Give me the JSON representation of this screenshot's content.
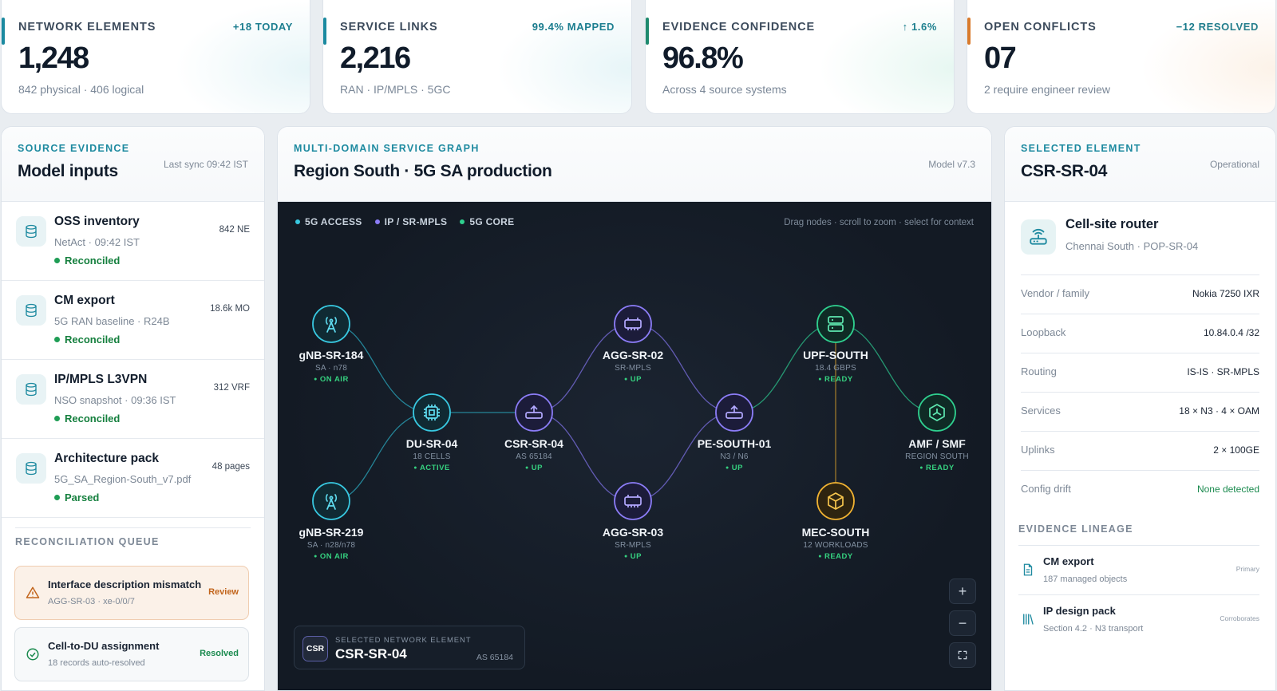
{
  "kpis": [
    {
      "label": "NETWORK ELEMENTS",
      "badge": "+18 TODAY",
      "value": "1,248",
      "sub": "842 physical · 406 logical"
    },
    {
      "label": "SERVICE LINKS",
      "badge": "99.4% MAPPED",
      "value": "2,216",
      "sub": "RAN · IP/MPLS · 5GC"
    },
    {
      "label": "EVIDENCE CONFIDENCE",
      "badge": "↑ 1.6%",
      "value": "96.8%",
      "sub": "Across 4 source systems"
    },
    {
      "label": "OPEN CONFLICTS",
      "badge": "−12 RESOLVED",
      "value": "07",
      "sub": "2 require engineer review"
    }
  ],
  "kpi_accents": [
    "#1b8aa0",
    "#1b8aa0",
    "#1f8a6e",
    "#d97a2b"
  ],
  "left": {
    "eyebrow": "SOURCE EVIDENCE",
    "title": "Model inputs",
    "meta": "Last sync 09:42 IST",
    "sources": [
      {
        "title": "OSS inventory",
        "sub": "NetAct · 09:42 IST",
        "status": "Reconciled",
        "count": "842 NE",
        "icon": "database-icon"
      },
      {
        "title": "CM export",
        "sub": "5G RAN baseline · R24B",
        "status": "Reconciled",
        "count": "18.6k MO",
        "icon": "database-icon"
      },
      {
        "title": "IP/MPLS L3VPN",
        "sub": "NSO snapshot · 09:36 IST",
        "status": "Reconciled",
        "count": "312 VRF",
        "icon": "database-icon"
      },
      {
        "title": "Architecture pack",
        "sub": "5G_SA_Region-South_v7.pdf",
        "status": "Parsed",
        "count": "48 pages",
        "icon": "database-icon"
      }
    ],
    "queue_label": "RECONCILIATION QUEUE",
    "queue": [
      {
        "title": "Interface description mismatch",
        "sub": "AGG-SR-03 · xe-0/0/7",
        "action": "Review",
        "icon": "warning-icon"
      },
      {
        "title": "Cell-to-DU assignment",
        "sub": "18 records auto-resolved",
        "action": "Resolved",
        "icon": "check-circle-icon"
      }
    ]
  },
  "center": {
    "eyebrow": "MULTI-DOMAIN SERVICE GRAPH",
    "title": "Region South · 5G SA production",
    "meta": "Model v7.3",
    "legend": [
      {
        "label": "5G ACCESS",
        "color": "#38c8e0"
      },
      {
        "label": "IP / SR-MPLS",
        "color": "#8b7cf6"
      },
      {
        "label": "5G CORE",
        "color": "#2fd08f"
      }
    ],
    "hint": "Drag nodes · scroll to zoom · select for context",
    "nodes": [
      {
        "id": "gnb184",
        "name": "gNB-SR-184",
        "sub": "SA · n78",
        "status": "ON AIR",
        "domain": "access",
        "icon": "antenna-icon"
      },
      {
        "id": "gnb219",
        "name": "gNB-SR-219",
        "sub": "SA · n28/n78",
        "status": "ON AIR",
        "domain": "access",
        "icon": "antenna-icon"
      },
      {
        "id": "du04",
        "name": "DU-SR-04",
        "sub": "18 CELLS",
        "status": "ACTIVE",
        "domain": "access",
        "icon": "chip-icon"
      },
      {
        "id": "csr04",
        "name": "CSR-SR-04",
        "sub": "AS 65184",
        "status": "UP",
        "domain": "ip",
        "icon": "router-icon"
      },
      {
        "id": "agg02",
        "name": "AGG-SR-02",
        "sub": "SR-MPLS",
        "status": "UP",
        "domain": "ip",
        "icon": "switch-icon"
      },
      {
        "id": "agg03",
        "name": "AGG-SR-03",
        "sub": "SR-MPLS",
        "status": "UP",
        "domain": "ip",
        "icon": "switch-icon"
      },
      {
        "id": "pe01",
        "name": "PE-SOUTH-01",
        "sub": "N3 / N6",
        "status": "UP",
        "domain": "ip",
        "icon": "router-icon"
      },
      {
        "id": "upf",
        "name": "UPF-SOUTH",
        "sub": "18.4 GBPS",
        "status": "READY",
        "domain": "core",
        "icon": "server-icon"
      },
      {
        "id": "mec",
        "name": "MEC-SOUTH",
        "sub": "12 WORKLOADS",
        "status": "READY",
        "domain": "edge",
        "icon": "cube-icon"
      },
      {
        "id": "amf",
        "name": "AMF / SMF",
        "sub": "REGION SOUTH",
        "status": "READY",
        "domain": "core",
        "icon": "hexagon-icon"
      }
    ],
    "selected": {
      "eyebrow": "SELECTED NETWORK ELEMENT",
      "badge": "CSR",
      "name": "CSR-SR-04",
      "as": "AS 65184"
    },
    "zoom_in": "+",
    "zoom_out": "−",
    "fit": "⛶"
  },
  "right": {
    "eyebrow": "SELECTED ELEMENT",
    "title": "CSR-SR-04",
    "meta": "Operational",
    "element_title": "Cell-site router",
    "element_sub": "Chennai South · POP-SR-04",
    "props": [
      {
        "k": "Vendor / family",
        "v": "Nokia 7250 IXR"
      },
      {
        "k": "Loopback",
        "v": "10.84.0.4 /32"
      },
      {
        "k": "Routing",
        "v": "IS-IS · SR-MPLS"
      },
      {
        "k": "Services",
        "v": "18 × N3 · 4 × OAM"
      },
      {
        "k": "Uplinks",
        "v": "2 × 100GE"
      },
      {
        "k": "Config drift",
        "v": "None detected"
      }
    ],
    "lineage_label": "EVIDENCE LINEAGE",
    "lineage": [
      {
        "title": "CM export",
        "sub": "187 managed objects",
        "tag": "Primary",
        "icon": "document-icon"
      },
      {
        "title": "IP design pack",
        "sub": "Section 4.2 · N3 transport",
        "tag": "Corroborates",
        "icon": "library-icon"
      }
    ]
  }
}
